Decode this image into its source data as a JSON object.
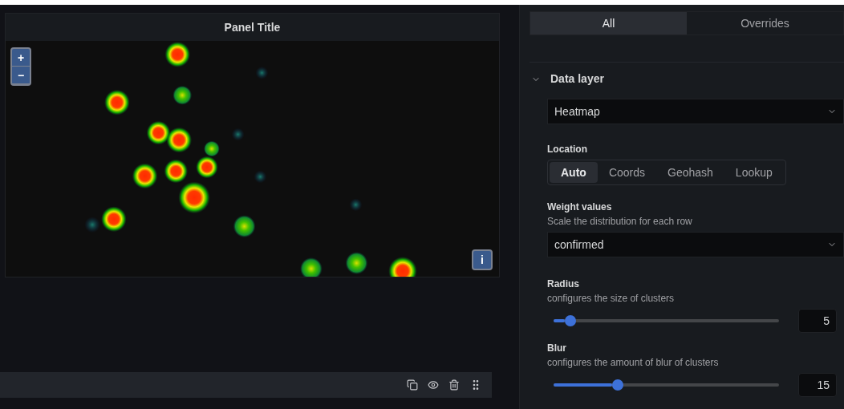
{
  "panel": {
    "title": "Panel Title",
    "zoom_controls": [
      "+",
      "−"
    ],
    "info_button": "i"
  },
  "options_pane": {
    "tabs": [
      {
        "label": "All",
        "selected": true
      },
      {
        "label": "Overrides",
        "selected": false
      }
    ],
    "section": {
      "title": "Data layer",
      "expanded": true,
      "layer_type": {
        "value": "Heatmap"
      },
      "location": {
        "label": "Location",
        "options": [
          {
            "label": "Auto",
            "selected": true
          },
          {
            "label": "Coords",
            "selected": false
          },
          {
            "label": "Geohash",
            "selected": false
          },
          {
            "label": "Lookup",
            "selected": false
          }
        ]
      },
      "weight": {
        "label": "Weight values",
        "description": "Scale the distribution for each row",
        "value": "confirmed"
      },
      "sliders": [
        {
          "label": "Radius",
          "description": "configures the size of clusters",
          "level": 0.075,
          "value": "5"
        },
        {
          "label": "Blur",
          "description": "configures the amount of blur of clusters",
          "level": 0.285,
          "value": "15"
        }
      ]
    }
  }
}
